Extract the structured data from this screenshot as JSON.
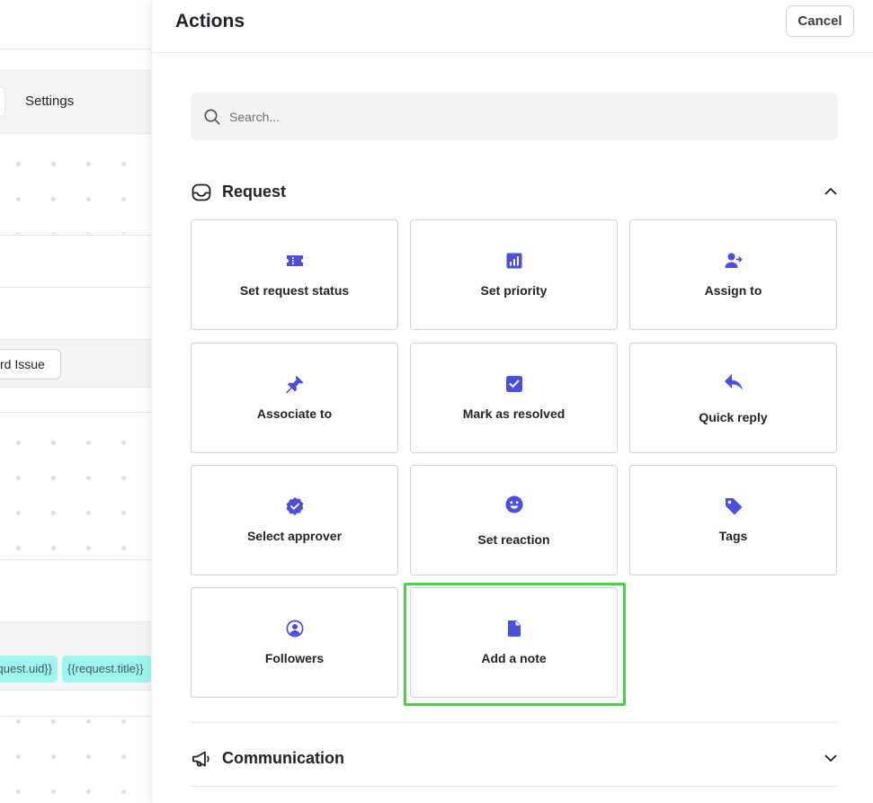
{
  "background": {
    "tabs": {
      "settings_label": "Settings"
    },
    "issue_button_label": "rd Issue",
    "chips": [
      "quest.uid}}",
      "{{request.title}}"
    ]
  },
  "panel": {
    "title": "Actions",
    "cancel_label": "Cancel",
    "search": {
      "placeholder": "Search..."
    },
    "sections": {
      "request": {
        "label": "Request",
        "expanded": true
      },
      "communication": {
        "label": "Communication",
        "expanded": false
      }
    },
    "actions": [
      {
        "label": "Set request status",
        "icon": "ticket-icon"
      },
      {
        "label": "Set priority",
        "icon": "bar-chart-icon"
      },
      {
        "label": "Assign to",
        "icon": "assign-user-icon"
      },
      {
        "label": "Associate to",
        "icon": "pin-icon"
      },
      {
        "label": "Mark as resolved",
        "icon": "checkbox-icon"
      },
      {
        "label": "Quick reply",
        "icon": "reply-arrow-icon"
      },
      {
        "label": "Select approver",
        "icon": "verified-badge-icon"
      },
      {
        "label": "Set reaction",
        "icon": "smiley-icon"
      },
      {
        "label": "Tags",
        "icon": "tag-icon"
      },
      {
        "label": "Followers",
        "icon": "user-circle-icon"
      },
      {
        "label": "Add a note",
        "icon": "note-icon",
        "highlighted": true
      }
    ],
    "colors": {
      "accent": "#4a4fe0",
      "highlight": "#4cd04c"
    }
  }
}
